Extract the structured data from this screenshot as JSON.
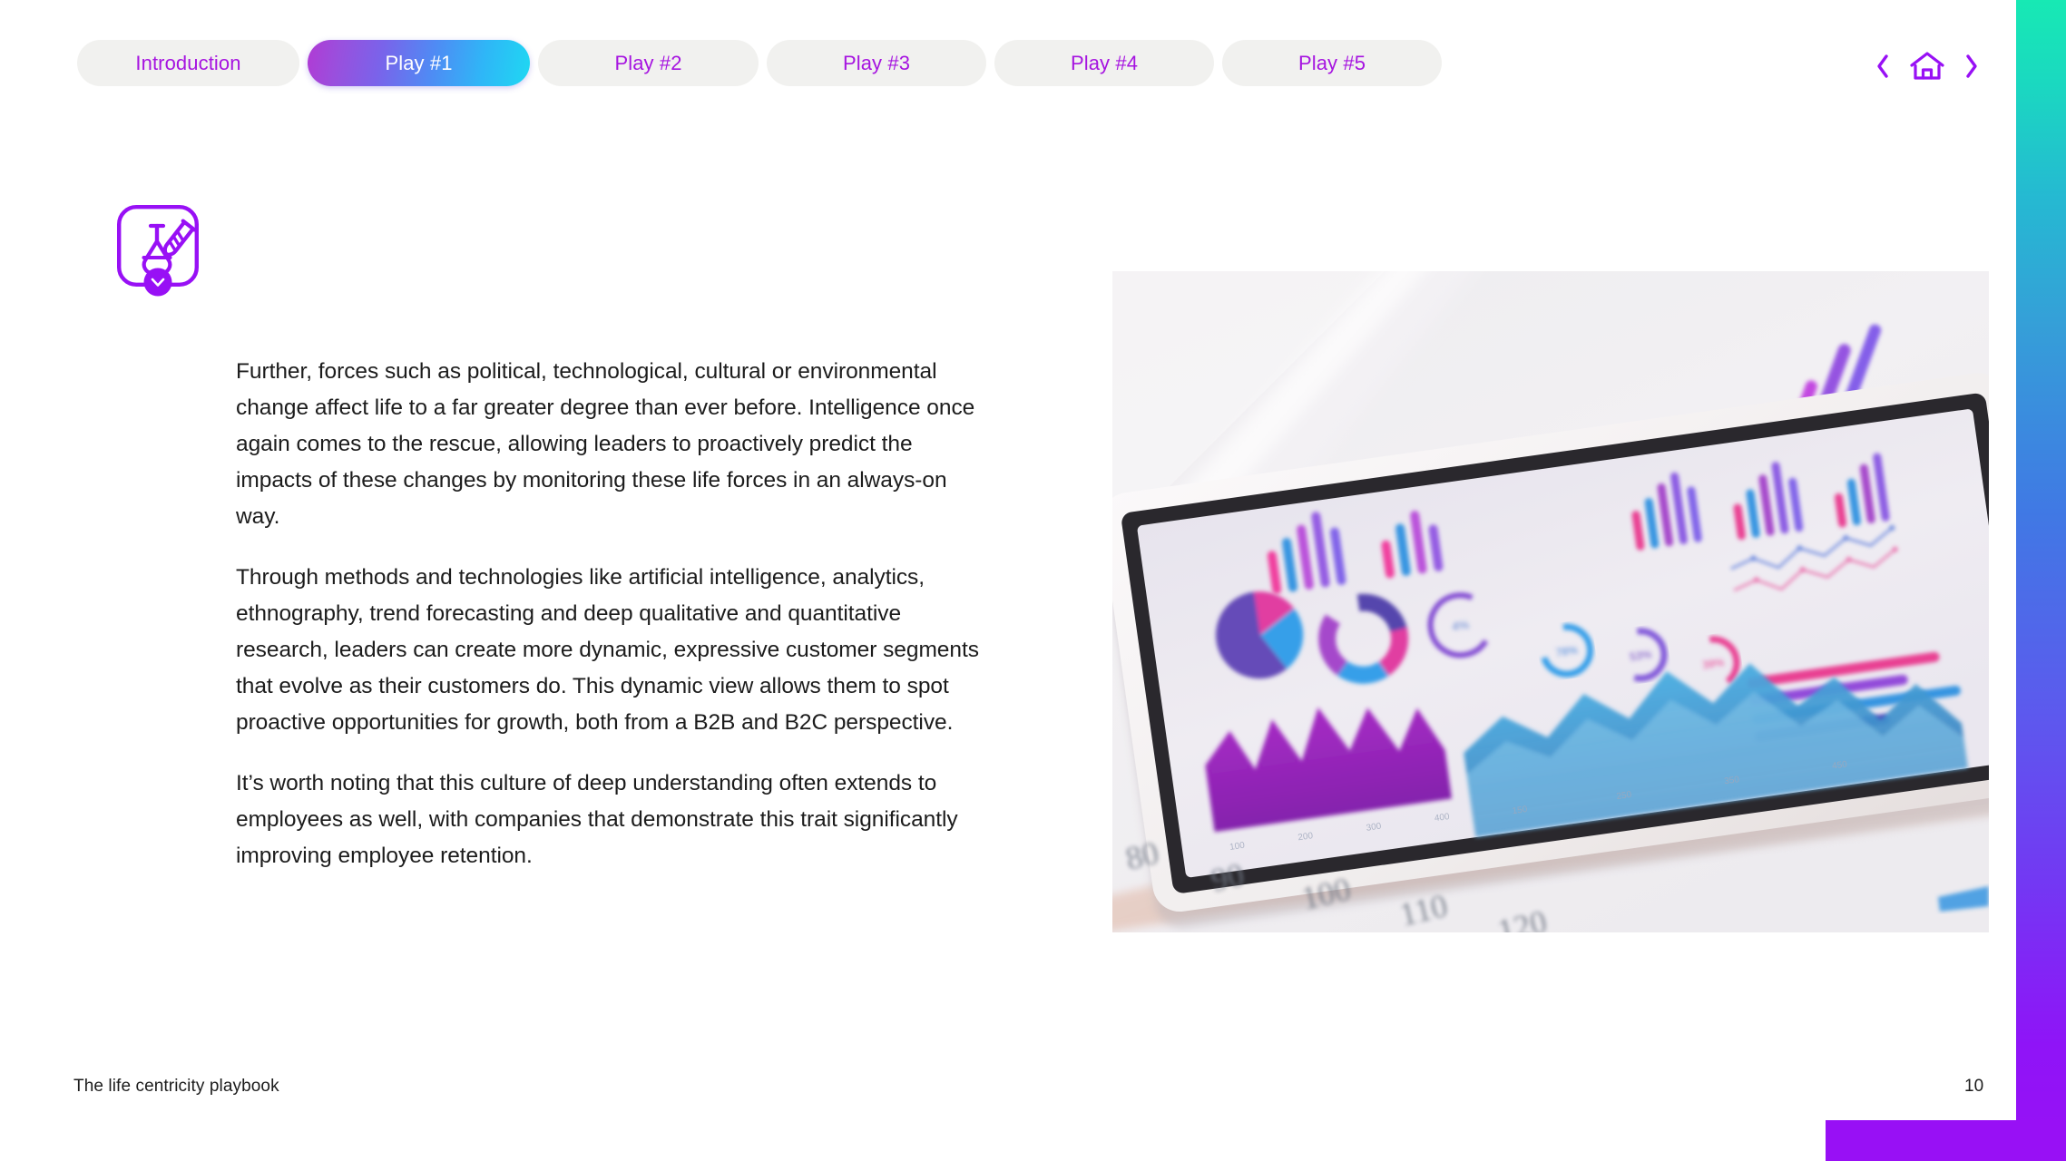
{
  "colors": {
    "accent_purple": "#9810f5",
    "tab_text_purple": "#a614e0",
    "tab_inactive_bg": "#f1f1ef",
    "text": "#1c1c1c",
    "edge_gradient_start": "#17e9b4",
    "edge_gradient_mid": "#4079e4",
    "edge_gradient_end": "#9810f5",
    "active_tab_gradient_start": "#b13ad4",
    "active_tab_gradient_mid": "#4f8bf4",
    "active_tab_gradient_end": "#1fd8f2"
  },
  "tabs": [
    {
      "label": "Introduction",
      "active": false
    },
    {
      "label": "Play #1",
      "active": true
    },
    {
      "label": "Play #2",
      "active": false
    },
    {
      "label": "Play #3",
      "active": false
    },
    {
      "label": "Play #4",
      "active": false
    },
    {
      "label": "Play #5",
      "active": false
    }
  ],
  "topnav": {
    "prev_label": "‹",
    "home_label": "home-icon",
    "next_label": "›"
  },
  "section_icon": {
    "name": "flask-and-test-tube-icon",
    "badge": "chevron-down-badge"
  },
  "main": {
    "paragraphs": [
      "Further, forces such as political, technological, cultural or environmental change affect life to a far greater degree than ever before. Intelligence once again comes to the rescue, allowing leaders to proactively predict the impacts of these changes by monitoring these life forces in an always-on way.",
      "Through methods and technologies like artificial intelligence, analytics, ethnography, trend forecasting and deep qualitative and quantitative research, leaders can create more dynamic, expressive customer segments that evolve as their customers do. This dynamic view allows them to spot proactive opportunities for growth, both from a B2B and B2C perspective.",
      "It’s worth noting that this culture of deep understanding often extends to employees as well, with companies that demonstrate this trait significantly improving employee retention."
    ]
  },
  "photo": {
    "alt": "Tablet on printed report pages displaying colourful analytics dashboard charts",
    "ruler_numbers": [
      "80",
      "90",
      "100",
      "110",
      "120"
    ]
  },
  "footer": {
    "title": "The life centricity playbook",
    "page_number": "10"
  }
}
